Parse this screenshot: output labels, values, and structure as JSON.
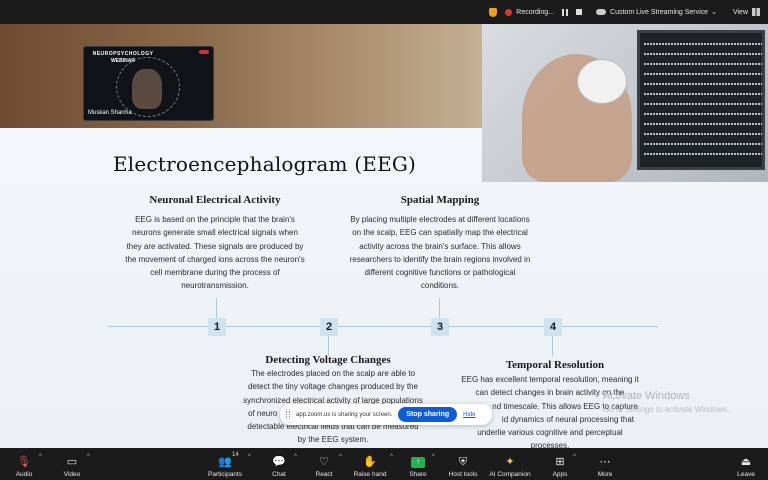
{
  "topbar": {
    "recording_label": "Recording...",
    "streaming_label": "Custom Live Streaming Service",
    "view_label": "View"
  },
  "webinar": {
    "title": "NEUROPSYCHOLOGY",
    "subtitle": "WEBINAR",
    "speaker_name": "Muskan Sharma"
  },
  "slide": {
    "title": "Electroencephalogram (EEG)",
    "sections": [
      {
        "heading": "Neuronal Electrical Activity",
        "lines": [
          "EEG is based on the principle that the brain's",
          "neurons generate small electrical signals when",
          "they are activated. These signals are produced by",
          "the movement of charged ions across the neuron's",
          "cell membrane during the process of",
          "neurotransmission."
        ]
      },
      {
        "heading": "Spatial Mapping",
        "lines": [
          "By placing multiple electrodes at different locations",
          "on the scalp, EEG can spatially map the electrical",
          "activity across the brain's surface. This allows",
          "researchers to identify the brain regions involved in",
          "different cognitive functions or pathological",
          "conditions."
        ]
      },
      {
        "heading": "Detecting Voltage Changes",
        "lines": [
          "The electrodes placed on the scalp are able to",
          "detect the tiny voltage changes produced by the",
          "synchronized electrical activity of large populations",
          "of neuro",
          "detectable electrical fields that can be measured",
          "by the EEG system."
        ]
      },
      {
        "heading": "Temporal Resolution",
        "lines": [
          "EEG has excellent temporal resolution, meaning it",
          "can detect changes in brain activity on the",
          "nd timescale. This allows EEG to capture",
          "id dynamics of neural processing that",
          "underlie various cognitive and perceptual",
          "processes."
        ]
      }
    ],
    "timeline": [
      "1",
      "2",
      "3",
      "4"
    ]
  },
  "watermark": {
    "line1": "Activate Windows",
    "line2": "Go to Settings to activate Windows."
  },
  "share_bar": {
    "message": "app.zoom.us is sharing your screen.",
    "stop_label": "Stop sharing",
    "hide_label": "Hide"
  },
  "toolbar": {
    "participants_count": "14",
    "items": {
      "audio": "Audio",
      "video": "Video",
      "participants": "Participants",
      "chat": "Chat",
      "react": "React",
      "raise_hand": "Raise hand",
      "share": "Share",
      "host_tools": "Host tools",
      "ai_companion": "AI Companion",
      "apps": "Apps",
      "more": "More",
      "leave": "Leave"
    }
  },
  "colors": {
    "accent_blue": "#0e5cd6",
    "share_green": "#20b34f",
    "recording_red": "#e03535"
  }
}
